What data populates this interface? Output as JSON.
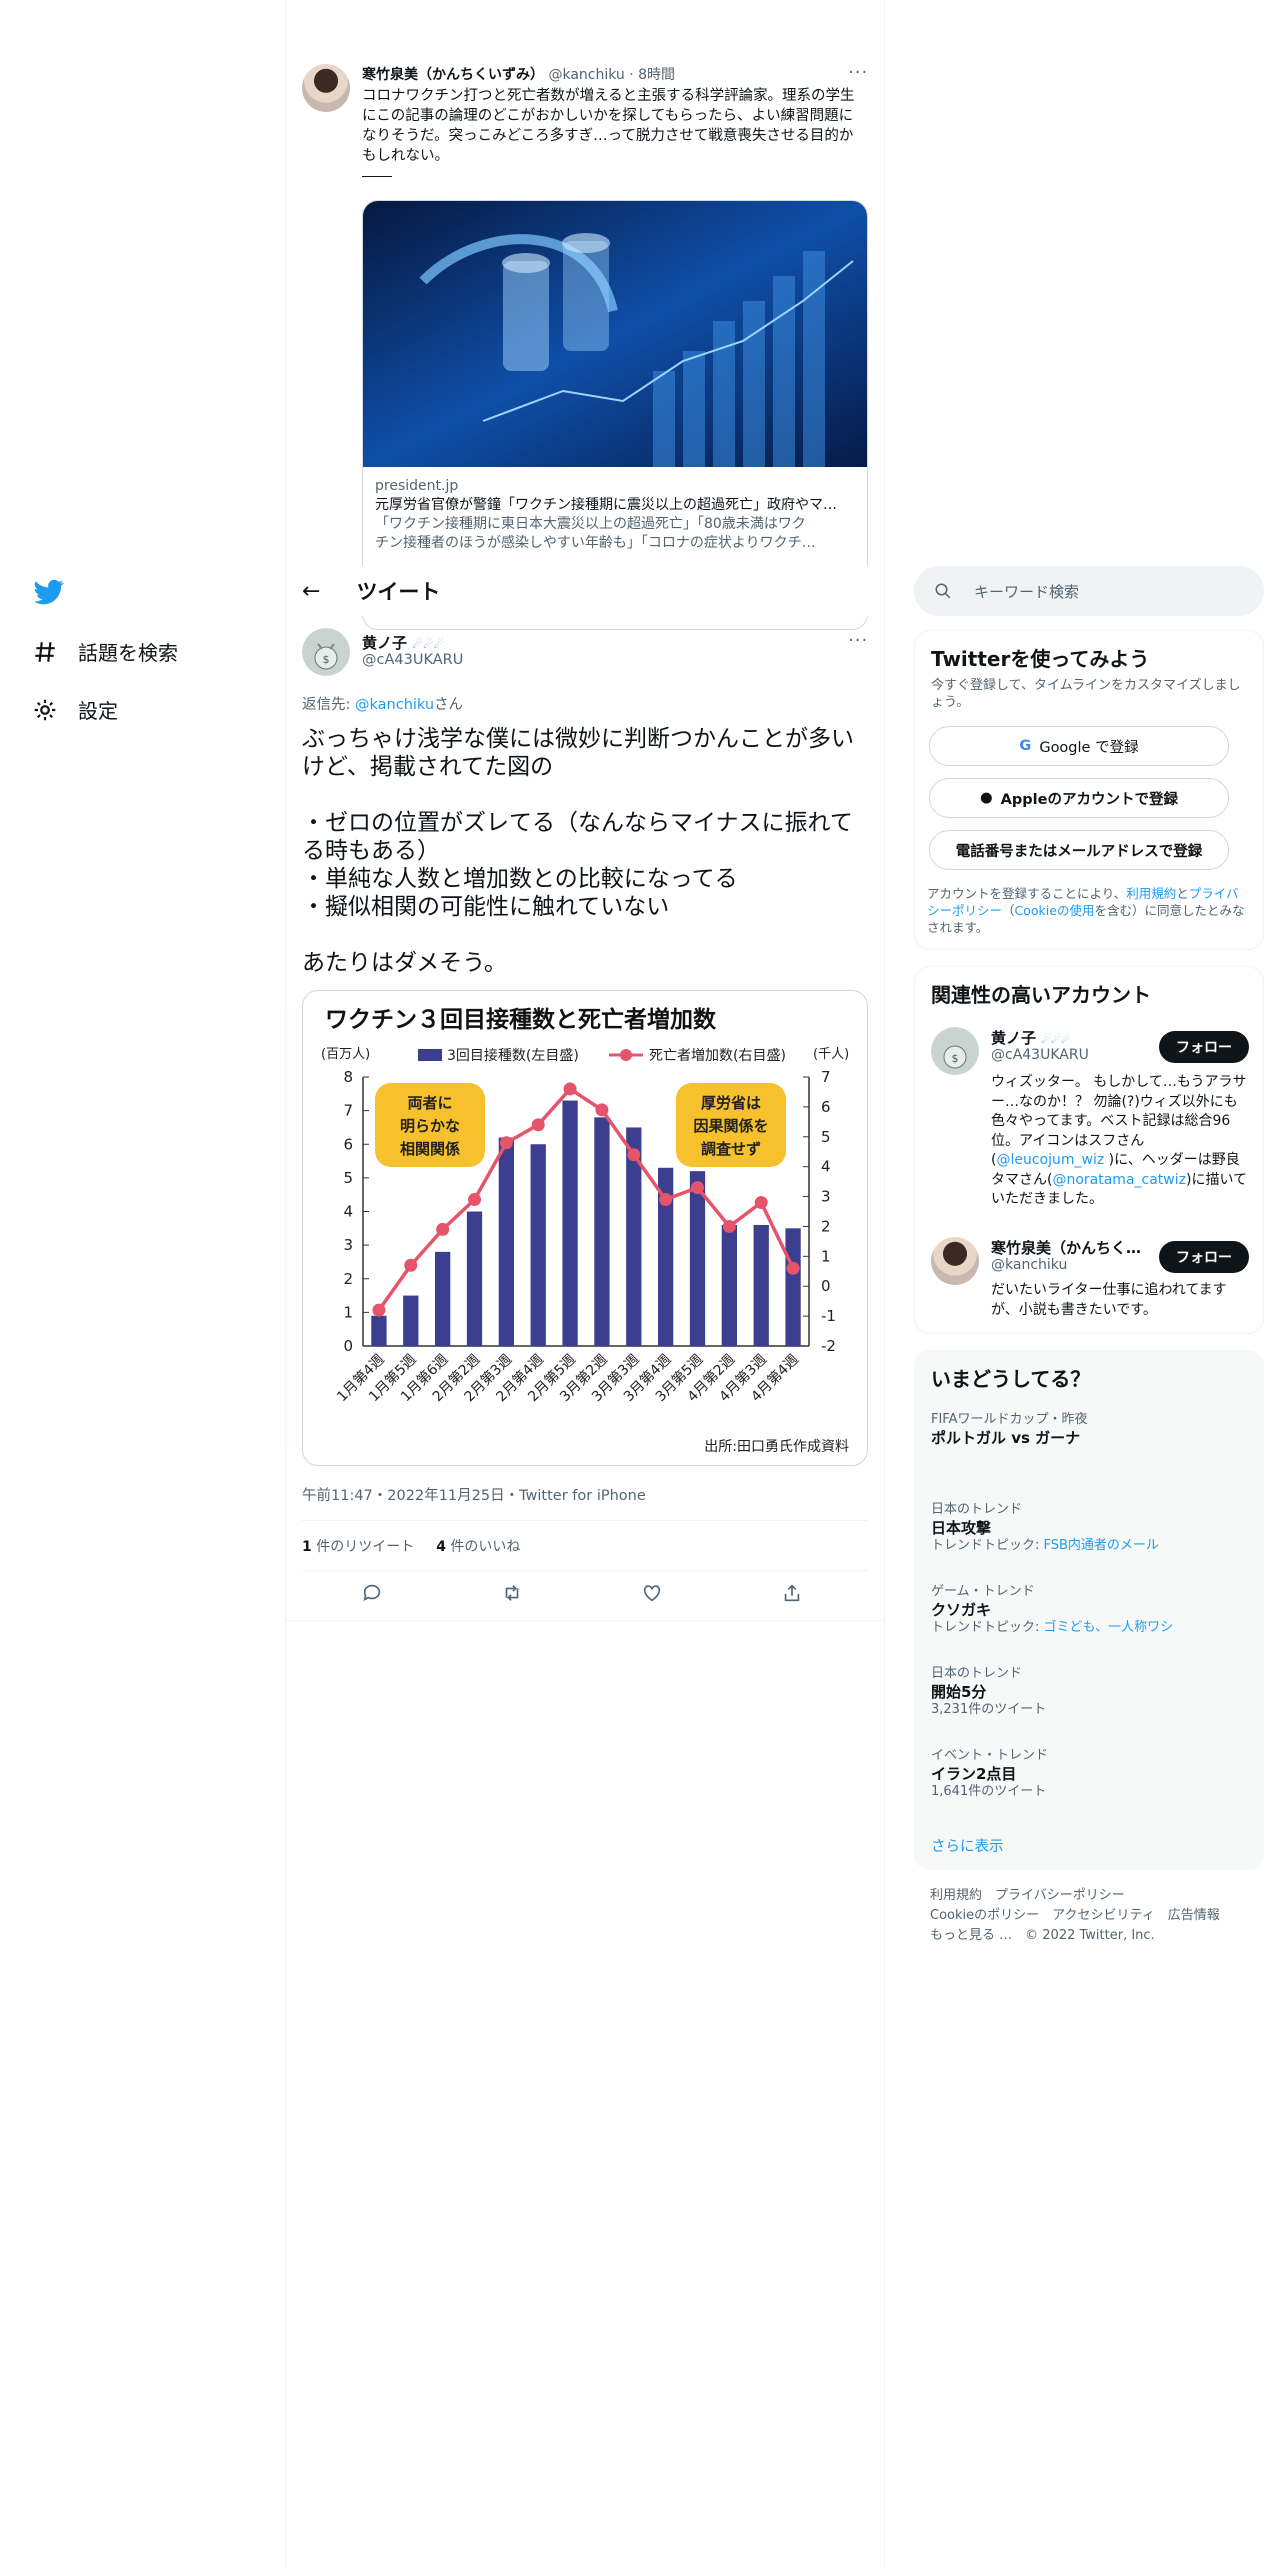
{
  "nav": {
    "explore": "話題を検索",
    "settings": "設定"
  },
  "quoted": {
    "name": "寒竹泉美（かんちくいずみ）",
    "handle": "@kanchiku",
    "time": "8時間",
    "text": "コロナワクチン打つと死亡者数が増えると主張する科学評論家。理系の学生にこの記事の論理のどこがおかしいかを探してもらったら、よい練習問題になりそうだ。突っこみどころ多すぎ…って脱力させて戦意喪失させる目的かもしれない。",
    "card": {
      "domain": "president.jp",
      "title": "元厚労省官僚が警鐘「ワクチン接種期に震災以上の超過死亡」政府やマ…",
      "desc1": "「ワクチン接種期に東日本大震災以上の超過死亡」「80歳未満はワク",
      "desc2": "チン接種者のほうが感染しやすい年齢も」「コロナの症状よりワクチ…"
    }
  },
  "header": {
    "title": "ツイート"
  },
  "tweet": {
    "name": "黄ノ子",
    "handle": "@cA43UKARU",
    "reply_prefix": "返信先: ",
    "reply_handle": "@kanchiku",
    "reply_suffix": "さん",
    "body": "ぶっちゃけ浅学な僕には微妙に判断つかんことが多いけど、掲載されてた図の\n\n・ゼロの位置がズレてる（なんならマイナスに振れてる時もある）\n・単純な人数と増加数との比較になってる\n・擬似相関の可能性に触れていない\n\nあたりはダメそう。",
    "meta": "午前11:47・2022年11月25日・Twitter for iPhone",
    "retweets": "1",
    "retweets_label": " 件のリツイート",
    "likes": "4",
    "likes_label": " 件のいいね"
  },
  "chart_data": {
    "type": "bar",
    "title": "ワクチン３回目接種数と死亡者増加数",
    "ylabel_left": "(百万人)",
    "ylabel_right": "(千人)",
    "legend_bar": "3回目接種数(左目盛)",
    "legend_line": "死亡者増加数(右目盛)",
    "bubble_left": [
      "両者に",
      "明らかな",
      "相関関係"
    ],
    "bubble_right": [
      "厚労省は",
      "因果関係を",
      "調査せず"
    ],
    "source": "出所:田口勇氏作成資料",
    "categories": [
      "1月第4週",
      "1月第5週",
      "1月第6週",
      "2月第2週",
      "2月第3週",
      "2月第4週",
      "2月第5週",
      "3月第2週",
      "3月第3週",
      "3月第4週",
      "3月第5週",
      "4月第2週",
      "4月第3週",
      "4月第4週"
    ],
    "series": [
      {
        "name": "3回目接種数(左目盛)",
        "axis": "left",
        "values": [
          0.9,
          1.5,
          2.8,
          4.0,
          6.2,
          6.0,
          7.3,
          6.8,
          6.5,
          5.3,
          5.2,
          3.6,
          3.6,
          3.5
        ]
      },
      {
        "name": "死亡者増加数(右目盛)",
        "axis": "right",
        "values": [
          -0.8,
          0.7,
          1.9,
          2.9,
          4.8,
          5.4,
          6.6,
          5.9,
          4.4,
          2.9,
          3.3,
          2.0,
          2.8,
          0.6
        ]
      }
    ],
    "ylim_left": [
      0,
      8
    ],
    "ylim_right": [
      -2,
      7
    ],
    "yticks_left": [
      "0",
      "1",
      "2",
      "3",
      "4",
      "5",
      "6",
      "7",
      "8"
    ],
    "yticks_right": [
      "-2",
      "-1",
      "0",
      "1",
      "2",
      "3",
      "4",
      "5",
      "6",
      "7"
    ],
    "colors": {
      "bar": "#3c3f8f",
      "line": "#e5546a",
      "bubble": "#f6c12d"
    }
  },
  "sidebar": {
    "search_placeholder": "キーワード検索",
    "signup": {
      "title": "Twitterを使ってみよう",
      "desc": "今すぐ登録して、タイムラインをカスタマイズしましょう。",
      "google": "Google で登録",
      "apple": "Appleのアカウントで登録",
      "phone": "電話番号またはメールアドレスで登録",
      "legal1": "アカウントを登録することにより、",
      "terms": "利用規約",
      "and": "と",
      "privacy": "プライバシーポリシー",
      "paren_open": "（",
      "cookie": "Cookieの使用",
      "legal2": "を含む）に同意したとみなされます。"
    },
    "related": {
      "title": "関連性の高いアカウント",
      "follow": "フォロー",
      "acc1": {
        "name": "黄ノ子",
        "handle": "@cA43UKARU",
        "bio1": "ウィズッター。 もしかして…もうアラサー…なのか！？ 勿論(?)ウィズ以外にも色々やってます。ベスト記録は総合96位。アイコンはスフさん(",
        "bio_link1": "@leucojum_wiz",
        "bio2": " )に、ヘッダーは野良タマさん(",
        "bio_link2": "@noratama_catwiz",
        "bio3": ")に描いていただきました。"
      },
      "acc2": {
        "name": "寒竹泉美（かんちく…",
        "handle": "@kanchiku",
        "bio": "だいたいライター仕事に追われてますが、小説も書きたいです。"
      }
    },
    "trends": {
      "title": "いまどうしてる？",
      "show_more": "さらに表示",
      "items": [
        {
          "cat": "FIFAワールドカップ・昨夜",
          "name": "ポルトガル vs ガーナ"
        },
        {
          "cat": "日本のトレンド",
          "name": "日本攻撃",
          "topic_label": "トレンドトピック: ",
          "topic": "FSB内通者のメール"
        },
        {
          "cat": "ゲーム・トレンド",
          "name": "クソガキ",
          "topic_label": "トレンドトピック: ",
          "topic": "ゴミども、一人称ワシ"
        },
        {
          "cat": "日本のトレンド",
          "name": "開始5分",
          "count": "3,231件のツイート"
        },
        {
          "cat": "イベント・トレンド",
          "name": "イラン2点目",
          "count": "1,641件のツイート"
        }
      ]
    },
    "footer": {
      "terms": "利用規約",
      "privacy": "プライバシーポリシー",
      "cookie": "Cookieのポリシー",
      "access": "アクセシビリティ",
      "ads": "広告情報",
      "more": "もっと見る …",
      "copy": "© 2022 Twitter, Inc."
    }
  }
}
